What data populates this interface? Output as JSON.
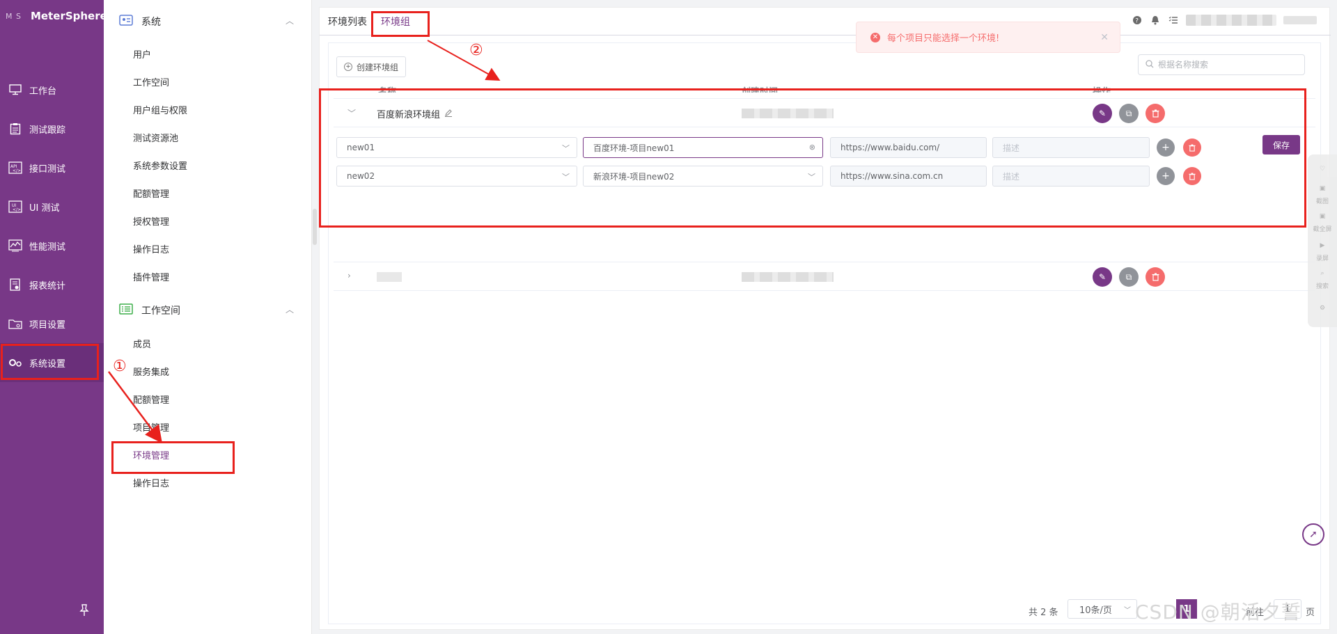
{
  "brand": {
    "logo": "M S",
    "name": "MeterSphere"
  },
  "nav": {
    "items": [
      {
        "label": "工作台",
        "icon": "monitor-icon"
      },
      {
        "label": "测试跟踪",
        "icon": "clipboard-icon"
      },
      {
        "label": "接口测试",
        "icon": "api-icon"
      },
      {
        "label": "UI 测试",
        "icon": "ui-icon"
      },
      {
        "label": "性能测试",
        "icon": "chart-icon"
      },
      {
        "label": "报表统计",
        "icon": "report-icon"
      },
      {
        "label": "项目设置",
        "icon": "folder-icon"
      },
      {
        "label": "系统设置",
        "icon": "settings-icon",
        "active": true
      }
    ],
    "pin_icon": "pin-icon"
  },
  "submenu": {
    "system_group": "系统",
    "system_items": [
      "用户",
      "工作空间",
      "用户组与权限",
      "测试资源池",
      "系统参数设置",
      "配额管理",
      "授权管理",
      "操作日志",
      "插件管理"
    ],
    "workspace_group": "工作空间",
    "workspace_items": [
      "成员",
      "服务集成",
      "配额管理",
      "项目管理",
      "环境管理",
      "操作日志"
    ],
    "active_item": "环境管理"
  },
  "tabs": {
    "env_list": "环境列表",
    "env_group": "环境组"
  },
  "toast": {
    "message": "每个项目只能选择一个环境!"
  },
  "toolbar": {
    "create_label": "创建环境组",
    "search_placeholder": "根据名称搜索"
  },
  "table": {
    "headers": [
      "名称",
      "创建时间",
      "操作"
    ],
    "groups": [
      {
        "name": "百度新浪环境组",
        "expanded": true,
        "envs": [
          {
            "project": "new01",
            "environment": "百度环境-项目new01",
            "url": "https://www.baidu.com/",
            "description_placeholder": "描述"
          },
          {
            "project": "new02",
            "environment": "新浪环境-项目new02",
            "url": "https://www.sina.com.cn",
            "description_placeholder": "描述"
          }
        ]
      },
      {
        "name": "",
        "expanded": false
      }
    ],
    "save_label": "保存"
  },
  "pagination": {
    "total": "共 2 条",
    "page_size": "10条/页",
    "current_page": "1",
    "goto_label": "前往",
    "goto_value": "1",
    "page_unit": "页"
  },
  "side_tool": {
    "labels": [
      "截图",
      "截全屏",
      "录屏",
      "搜索"
    ]
  },
  "annotations": {
    "step1": "①",
    "step2": "②"
  },
  "watermark": "CSDN @朝活夕誓",
  "colors": {
    "primary": "#783887",
    "danger": "#f56c6c",
    "annotation": "#e8211d"
  }
}
